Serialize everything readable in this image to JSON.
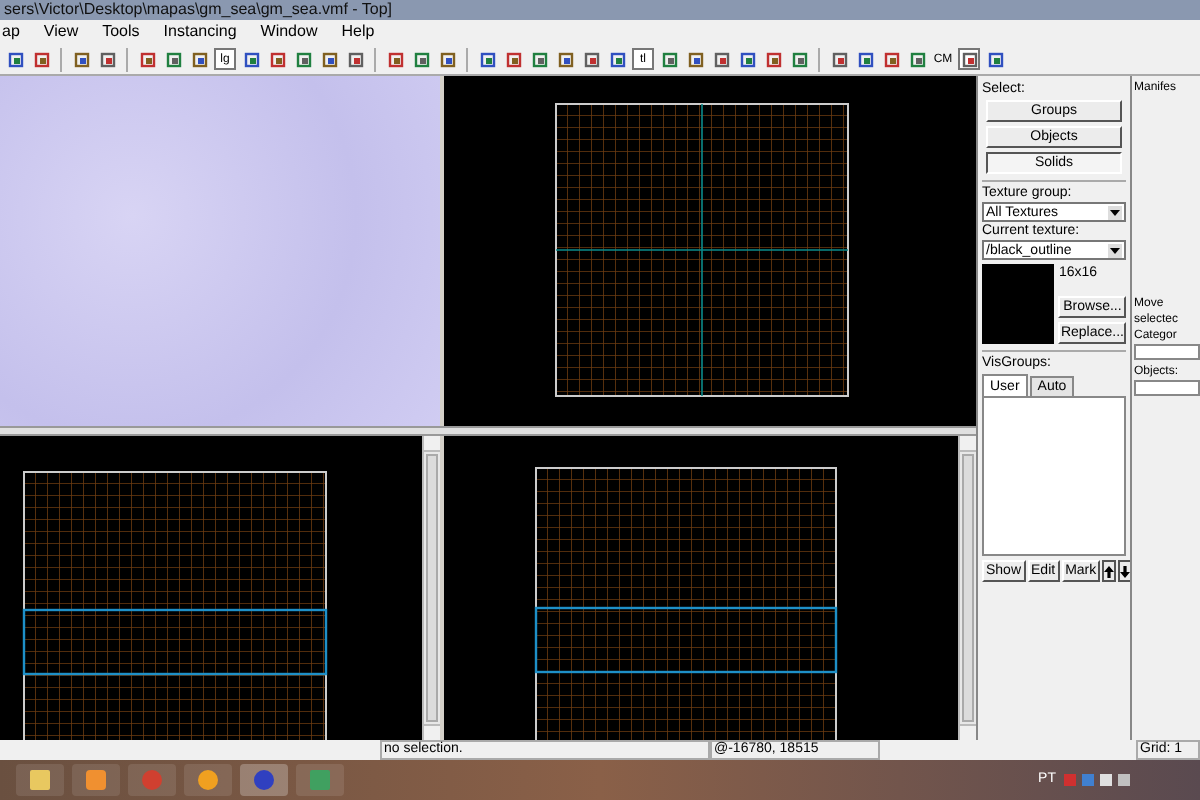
{
  "window": {
    "title": "sers\\Victor\\Desktop\\mapas\\gm_sea\\gm_sea.vmf - Top]"
  },
  "menu": [
    "ap",
    "View",
    "Tools",
    "Instancing",
    "Window",
    "Help"
  ],
  "toolbar": [
    {
      "kind": "icon",
      "selected": false
    },
    {
      "kind": "icon",
      "selected": false
    },
    {
      "kind": "sep"
    },
    {
      "kind": "icon",
      "selected": false
    },
    {
      "kind": "icon",
      "selected": false
    },
    {
      "kind": "sep"
    },
    {
      "kind": "icon",
      "selected": false
    },
    {
      "kind": "icon",
      "selected": false
    },
    {
      "kind": "icon",
      "selected": false
    },
    {
      "kind": "text",
      "text": "lg",
      "selected": true
    },
    {
      "kind": "icon",
      "selected": false
    },
    {
      "kind": "icon",
      "selected": false
    },
    {
      "kind": "icon",
      "selected": false
    },
    {
      "kind": "icon",
      "selected": false
    },
    {
      "kind": "icon",
      "selected": false
    },
    {
      "kind": "sep"
    },
    {
      "kind": "icon",
      "selected": false
    },
    {
      "kind": "icon",
      "selected": false
    },
    {
      "kind": "icon",
      "selected": false
    },
    {
      "kind": "sep"
    },
    {
      "kind": "icon",
      "selected": false
    },
    {
      "kind": "icon",
      "selected": false
    },
    {
      "kind": "icon",
      "selected": false
    },
    {
      "kind": "icon",
      "selected": false
    },
    {
      "kind": "icon",
      "selected": false
    },
    {
      "kind": "icon",
      "selected": false
    },
    {
      "kind": "text",
      "text": "tl",
      "selected": true
    },
    {
      "kind": "icon",
      "selected": false
    },
    {
      "kind": "icon",
      "selected": false
    },
    {
      "kind": "icon",
      "selected": false
    },
    {
      "kind": "icon",
      "selected": false
    },
    {
      "kind": "icon",
      "selected": false
    },
    {
      "kind": "icon",
      "selected": false
    },
    {
      "kind": "sep"
    },
    {
      "kind": "icon",
      "selected": false
    },
    {
      "kind": "icon",
      "selected": false
    },
    {
      "kind": "icon",
      "selected": false
    },
    {
      "kind": "icon",
      "selected": false
    },
    {
      "kind": "text",
      "text": "CM",
      "selected": false
    },
    {
      "kind": "icon",
      "selected": true
    },
    {
      "kind": "icon",
      "selected": false
    }
  ],
  "select_panel": {
    "label": "Select:",
    "buttons": [
      {
        "label": "Groups",
        "selected": false
      },
      {
        "label": "Objects",
        "selected": false
      },
      {
        "label": "Solids",
        "selected": true
      }
    ]
  },
  "texture": {
    "group_label": "Texture group:",
    "group_value": "All Textures",
    "current_label": "Current texture:",
    "current_value": "/black_outline",
    "size": "16x16",
    "buttons": [
      "Browse...",
      "Replace..."
    ]
  },
  "visgroups": {
    "label": "VisGroups:",
    "tabs": [
      {
        "label": "User",
        "selected": true
      },
      {
        "label": "Auto",
        "selected": false
      }
    ],
    "buttons": [
      "Show",
      "Edit",
      "Mark"
    ]
  },
  "side_panel": {
    "title": "Manifes",
    "move_label": [
      "Move",
      "selectec"
    ],
    "category_label": "Categor",
    "objects_label": "Objects:"
  },
  "status_bar": {
    "selection": "no selection.",
    "coordinates": "@-16780, 18515",
    "grid": "Grid: 1"
  },
  "taskbar": {
    "language": "PT"
  }
}
